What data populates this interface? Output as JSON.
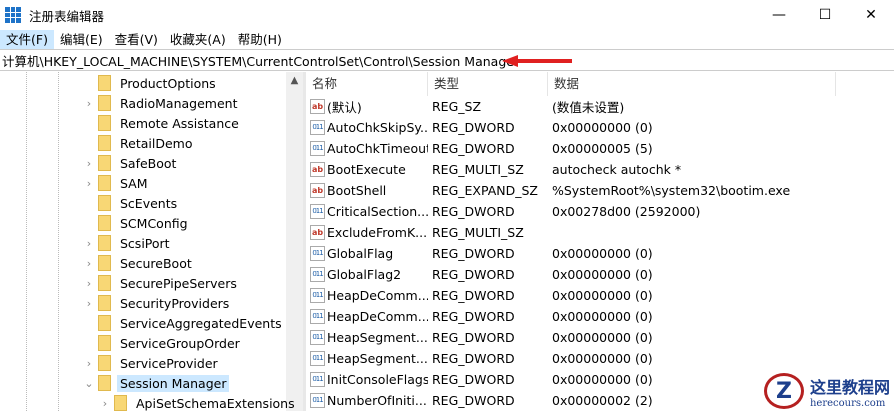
{
  "window": {
    "title": "注册表编辑器",
    "minimize": "—",
    "maximize": "☐",
    "close": "✕"
  },
  "menu": [
    "文件(F)",
    "编辑(E)",
    "查看(V)",
    "收藏夹(A)",
    "帮助(H)"
  ],
  "address": "计算机\\HKEY_LOCAL_MACHINE\\SYSTEM\\CurrentControlSet\\Control\\Session Manager",
  "tree": [
    {
      "label": "ProductOptions",
      "exp": ""
    },
    {
      "label": "RadioManagement",
      "exp": "›"
    },
    {
      "label": "Remote Assistance",
      "exp": ""
    },
    {
      "label": "RetailDemo",
      "exp": ""
    },
    {
      "label": "SafeBoot",
      "exp": "›"
    },
    {
      "label": "SAM",
      "exp": "›"
    },
    {
      "label": "ScEvents",
      "exp": ""
    },
    {
      "label": "SCMConfig",
      "exp": ""
    },
    {
      "label": "ScsiPort",
      "exp": "›"
    },
    {
      "label": "SecureBoot",
      "exp": "›"
    },
    {
      "label": "SecurePipeServers",
      "exp": "›"
    },
    {
      "label": "SecurityProviders",
      "exp": "›"
    },
    {
      "label": "ServiceAggregatedEvents",
      "exp": ""
    },
    {
      "label": "ServiceGroupOrder",
      "exp": ""
    },
    {
      "label": "ServiceProvider",
      "exp": "›"
    },
    {
      "label": "Session Manager",
      "exp": "⌄",
      "selected": true
    },
    {
      "label": "ApiSetSchemaExtensions",
      "exp": "›",
      "child": true
    }
  ],
  "columns": {
    "name": "名称",
    "type": "类型",
    "data": "数据"
  },
  "values": [
    {
      "icon": "sz",
      "name": "(默认)",
      "type": "REG_SZ",
      "data": "(数值未设置)"
    },
    {
      "icon": "bin",
      "name": "AutoChkSkipSy...",
      "type": "REG_DWORD",
      "data": "0x00000000 (0)"
    },
    {
      "icon": "bin",
      "name": "AutoChkTimeout",
      "type": "REG_DWORD",
      "data": "0x00000005 (5)"
    },
    {
      "icon": "sz",
      "name": "BootExecute",
      "type": "REG_MULTI_SZ",
      "data": "autocheck autochk *"
    },
    {
      "icon": "sz",
      "name": "BootShell",
      "type": "REG_EXPAND_SZ",
      "data": "%SystemRoot%\\system32\\bootim.exe"
    },
    {
      "icon": "bin",
      "name": "CriticalSection...",
      "type": "REG_DWORD",
      "data": "0x00278d00 (2592000)"
    },
    {
      "icon": "sz",
      "name": "ExcludeFromK...",
      "type": "REG_MULTI_SZ",
      "data": ""
    },
    {
      "icon": "bin",
      "name": "GlobalFlag",
      "type": "REG_DWORD",
      "data": "0x00000000 (0)"
    },
    {
      "icon": "bin",
      "name": "GlobalFlag2",
      "type": "REG_DWORD",
      "data": "0x00000000 (0)"
    },
    {
      "icon": "bin",
      "name": "HeapDeComm...",
      "type": "REG_DWORD",
      "data": "0x00000000 (0)"
    },
    {
      "icon": "bin",
      "name": "HeapDeComm...",
      "type": "REG_DWORD",
      "data": "0x00000000 (0)"
    },
    {
      "icon": "bin",
      "name": "HeapSegment...",
      "type": "REG_DWORD",
      "data": "0x00000000 (0)"
    },
    {
      "icon": "bin",
      "name": "HeapSegment...",
      "type": "REG_DWORD",
      "data": "0x00000000 (0)"
    },
    {
      "icon": "bin",
      "name": "InitConsoleFlags",
      "type": "REG_DWORD",
      "data": "0x00000000 (0)"
    },
    {
      "icon": "bin",
      "name": "NumberOfIniti...",
      "type": "REG_DWORD",
      "data": "0x00000002 (2)"
    }
  ],
  "watermark": {
    "title": "这里教程网",
    "url": "herecours.com"
  },
  "colors": {
    "selection": "#cce8ff",
    "arrow": "#e02020",
    "folder": "#f8d775"
  }
}
